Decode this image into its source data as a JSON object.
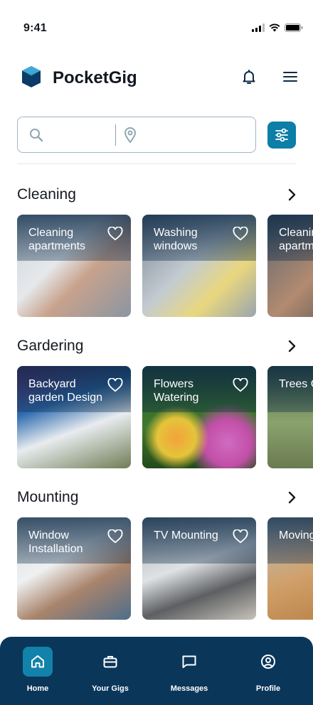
{
  "status": {
    "time": "9:41"
  },
  "app": {
    "title": "PocketGig"
  },
  "search": {
    "placeholder": "",
    "location_placeholder": ""
  },
  "sections": [
    {
      "title": "Cleaning",
      "cards": [
        {
          "title": "Cleaning apartments"
        },
        {
          "title": "Washing windows"
        },
        {
          "title": "Cleaning apartments"
        }
      ]
    },
    {
      "title": "Gardering",
      "cards": [
        {
          "title": "Backyard garden Design"
        },
        {
          "title": "Flowers Watering"
        },
        {
          "title": "Trees Cutting"
        }
      ]
    },
    {
      "title": "Mounting",
      "cards": [
        {
          "title": "Window Installation"
        },
        {
          "title": "TV Mounting"
        },
        {
          "title": "Moving boxes"
        }
      ]
    }
  ],
  "nav": [
    {
      "label": "Home",
      "icon": "home-icon",
      "active": true
    },
    {
      "label": "Your Gigs",
      "icon": "briefcase-icon",
      "active": false
    },
    {
      "label": "Messages",
      "icon": "chat-icon",
      "active": false
    },
    {
      "label": "Profile",
      "icon": "profile-icon",
      "active": false
    }
  ],
  "colors": {
    "brand": "#0d7ea6",
    "nav_background": "#0a3659",
    "nav_active": "#1382aa",
    "logo_dark": "#0b3b66",
    "logo_light": "#3fa9d6"
  }
}
